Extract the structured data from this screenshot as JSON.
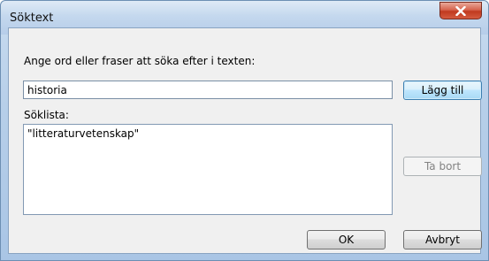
{
  "dialog": {
    "title": "Söktext",
    "prompt_label": "Ange ord eller fraser att söka efter i texten:",
    "input_value": "historia",
    "list_label": "Söklista:",
    "list_items": [
      "\"litteraturvetenskap\""
    ],
    "buttons": {
      "add": "Lägg till",
      "remove": "Ta bort",
      "ok": "OK",
      "cancel": "Avbryt"
    }
  },
  "colors": {
    "close_button": "#c0391f",
    "default_button_border": "#3c7fb1",
    "dialog_background": "#f0f0f0"
  },
  "icons": {
    "close": "close-icon"
  }
}
